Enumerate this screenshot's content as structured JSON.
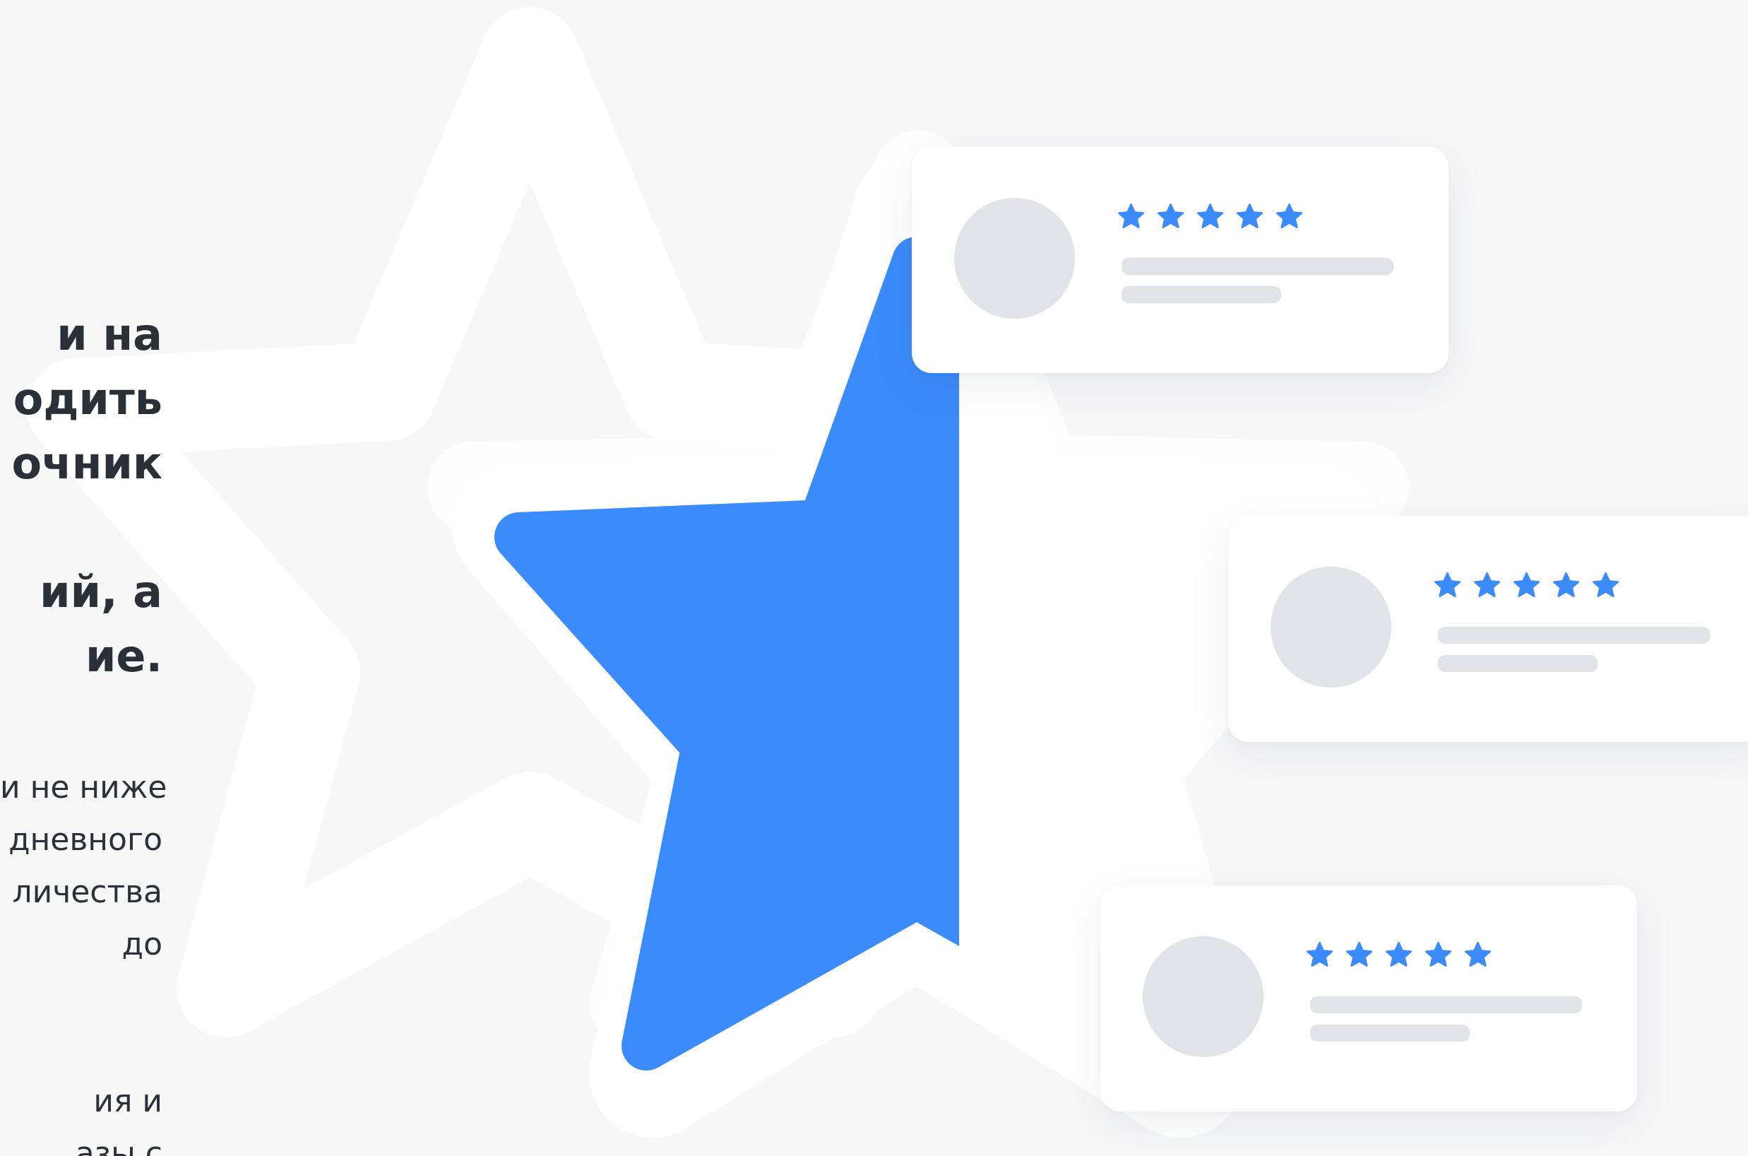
{
  "headline": {
    "lines": [
      "и на",
      "одить",
      "очник",
      "",
      "ий, а",
      "ие."
    ]
  },
  "description": {
    "lines": [
      "и не ниже",
      "дневного",
      "личества",
      "до",
      "",
      "ия и",
      "азы с"
    ]
  },
  "colors": {
    "background": "#f7f7f8",
    "accent_blue": "#3b8bfc",
    "star_outline": "#ffffff",
    "placeholder_gray": "#e2e3e8",
    "text_dark": "#2a3038"
  },
  "review_cards": [
    {
      "avatar_icon": "avatar-placeholder",
      "rating": 5
    },
    {
      "avatar_icon": "avatar-placeholder",
      "rating": 5
    },
    {
      "avatar_icon": "avatar-placeholder",
      "rating": 5
    }
  ],
  "illustration": {
    "main_star_icon": "half-filled-star-icon",
    "background_star_icon": "star-outline-icon",
    "main_star_fill_fraction": 0.5
  }
}
